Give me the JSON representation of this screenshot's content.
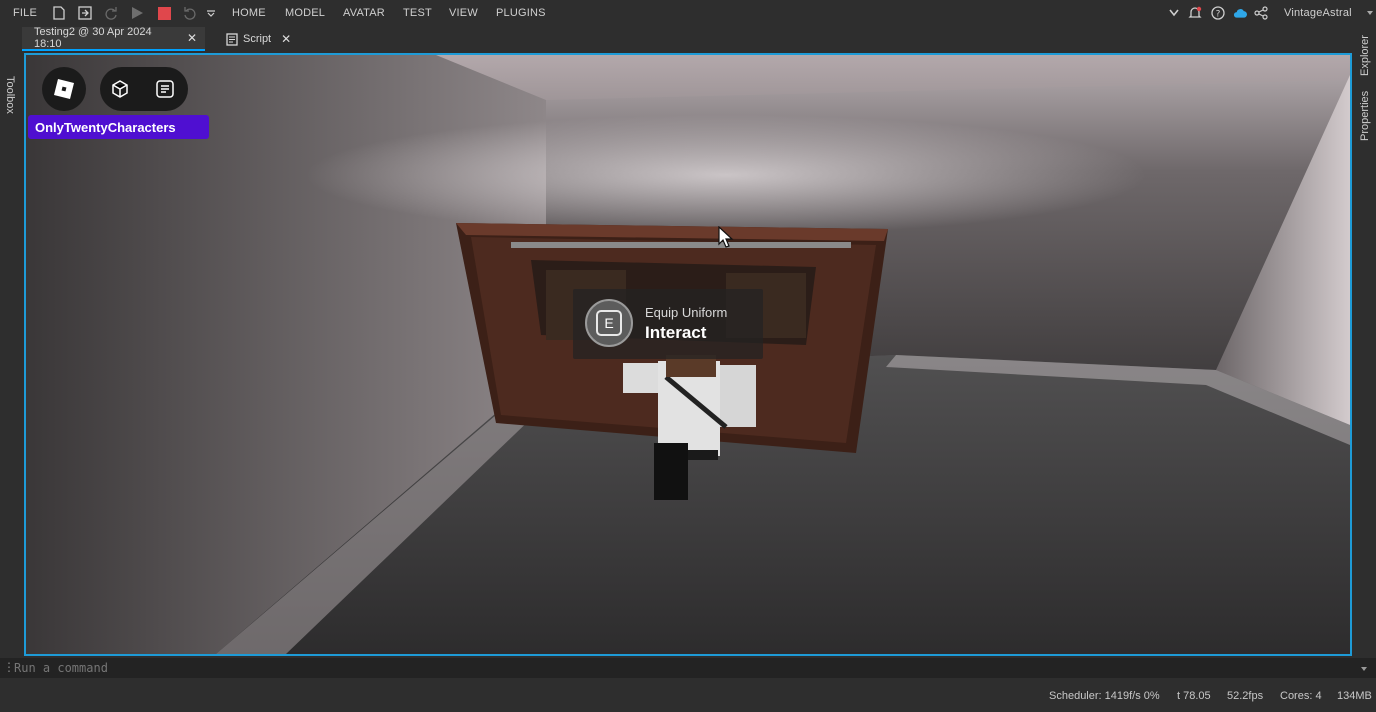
{
  "menu": {
    "file": "FILE",
    "tabs": [
      "HOME",
      "MODEL",
      "AVATAR",
      "TEST",
      "VIEW",
      "PLUGINS"
    ],
    "username": "VintageAstral"
  },
  "icons": {
    "new_file": "new-file-icon",
    "open": "open-icon",
    "redo": "redo-icon",
    "play": "play-icon",
    "stop": "stop-icon",
    "undo": "undo-icon",
    "more": "chevron-down-icon",
    "notifications": "bell-icon",
    "help": "help-icon",
    "cloud": "cloud-icon",
    "share": "share-icon"
  },
  "doc_tabs": [
    {
      "label": "Testing2 @ 30 Apr 2024 18:10"
    },
    {
      "label": "Script"
    }
  ],
  "sidebars": {
    "left": "Toolbox",
    "right_top": "Explorer",
    "right_bottom": "Properties"
  },
  "viewport": {
    "username_badge": "OnlyTwentyCharacters",
    "prompt": {
      "key": "E",
      "object_text": "Equip Uniform",
      "action_text": "Interact"
    }
  },
  "command_bar": {
    "placeholder": "Run a command"
  },
  "status": {
    "scheduler": "Scheduler: 1419f/s 0%",
    "time": "t 78.05",
    "fps": "52.2fps",
    "cores": "Cores: 4",
    "memory": "134MB"
  },
  "colors": {
    "accent": "#1e9bd7",
    "stop": "#e0474c",
    "badge": "#4f0fd1",
    "cloud": "#2fa7e8"
  }
}
